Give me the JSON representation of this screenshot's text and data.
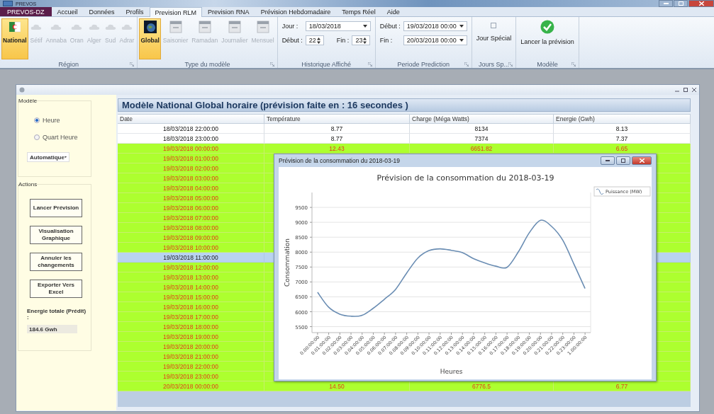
{
  "window": {
    "title": "PREVOS"
  },
  "app_menu": "PREVOS-DZ",
  "tabs": [
    {
      "label": "Accueil",
      "selected": false
    },
    {
      "label": "Données",
      "selected": false
    },
    {
      "label": "Profils",
      "selected": false
    },
    {
      "label": "Prevision RLM",
      "selected": true
    },
    {
      "label": "Prevision RNA",
      "selected": false
    },
    {
      "label": "Prévision Hebdomadaire",
      "selected": false
    },
    {
      "label": "Temps Réel",
      "selected": false
    },
    {
      "label": "Aide",
      "selected": false
    }
  ],
  "ribbon": {
    "region": {
      "title": "Région",
      "items": [
        {
          "label": "National",
          "selected": true,
          "disabled": false
        },
        {
          "label": "Sétif",
          "selected": false,
          "disabled": true
        },
        {
          "label": "Annaba",
          "selected": false,
          "disabled": true
        },
        {
          "label": "Oran",
          "selected": false,
          "disabled": true
        },
        {
          "label": "Alger",
          "selected": false,
          "disabled": true
        },
        {
          "label": "Sud",
          "selected": false,
          "disabled": true
        },
        {
          "label": "Adrar",
          "selected": false,
          "disabled": true
        }
      ]
    },
    "model_type": {
      "title": "Type du modèle",
      "items": [
        {
          "label": "Global",
          "selected": true,
          "disabled": false
        },
        {
          "label": "Saisonier",
          "selected": false,
          "disabled": true
        },
        {
          "label": "Ramadan",
          "selected": false,
          "disabled": true
        },
        {
          "label": "Journalier",
          "selected": false,
          "disabled": true
        },
        {
          "label": "Mensuel",
          "selected": false,
          "disabled": true
        }
      ]
    },
    "history": {
      "title": "Historique Affiché",
      "day_label": "Jour  :",
      "day_value": "18/03/2018",
      "start_label": "Début :",
      "start_value": "22",
      "end_label": "Fin :",
      "end_value": "23"
    },
    "period": {
      "title": "Periode Prediction",
      "start_label": "Début :",
      "start_value": "19/03/2018 00:00",
      "end_label": "Fin   :",
      "end_value": "20/03/2018 00:00"
    },
    "special_days": {
      "title": "Jours Sp...",
      "label": "Jour Spécial",
      "checked": false
    },
    "model": {
      "title": "Modèle",
      "label": "Lancer la prévision"
    }
  },
  "side_panel": {
    "model_group": "Modèle",
    "options": [
      {
        "label": "Heure",
        "selected": true
      },
      {
        "label": "Quart Heure",
        "selected": false
      }
    ],
    "mode": "Automatique",
    "actions_group": "Actions",
    "buttons": [
      "Lancer Prévision",
      "Visualisation Graphique",
      "Annuler les changements",
      "Exporter Vers Excel"
    ],
    "total_label": "Energie totale (Prédit) :",
    "total_value": "184.6 Gwh"
  },
  "table": {
    "title": "Modèle National Global horaire (prévision faite en : 16 secondes )",
    "columns": [
      "Date",
      "Température",
      "Charge (Méga Watts)",
      "Energie (Gwh)"
    ],
    "rows": [
      {
        "cells": [
          "18/03/2018 22:00:00",
          "8.77",
          "8134",
          "8.13"
        ],
        "forecast": false,
        "selected": false
      },
      {
        "cells": [
          "18/03/2018 23:00:00",
          "8.77",
          "7374",
          "7.37"
        ],
        "forecast": false,
        "selected": false
      },
      {
        "cells": [
          "19/03/2018 00:00:00",
          "12.43",
          "6651.82",
          "6.65"
        ],
        "forecast": true,
        "selected": false
      },
      {
        "cells": [
          "19/03/2018 01:00:00"
        ],
        "forecast": true,
        "selected": false
      },
      {
        "cells": [
          "19/03/2018 02:00:00"
        ],
        "forecast": true,
        "selected": false
      },
      {
        "cells": [
          "19/03/2018 03:00:00"
        ],
        "forecast": true,
        "selected": false
      },
      {
        "cells": [
          "19/03/2018 04:00:00"
        ],
        "forecast": true,
        "selected": false
      },
      {
        "cells": [
          "19/03/2018 05:00:00"
        ],
        "forecast": true,
        "selected": false
      },
      {
        "cells": [
          "19/03/2018 06:00:00"
        ],
        "forecast": true,
        "selected": false
      },
      {
        "cells": [
          "19/03/2018 07:00:00"
        ],
        "forecast": true,
        "selected": false
      },
      {
        "cells": [
          "19/03/2018 08:00:00"
        ],
        "forecast": true,
        "selected": false
      },
      {
        "cells": [
          "19/03/2018 09:00:00"
        ],
        "forecast": true,
        "selected": false
      },
      {
        "cells": [
          "19/03/2018 10:00:00"
        ],
        "forecast": true,
        "selected": false
      },
      {
        "cells": [
          "19/03/2018 11:00:00"
        ],
        "forecast": true,
        "selected": true
      },
      {
        "cells": [
          "19/03/2018 12:00:00"
        ],
        "forecast": true,
        "selected": false
      },
      {
        "cells": [
          "19/03/2018 13:00:00"
        ],
        "forecast": true,
        "selected": false
      },
      {
        "cells": [
          "19/03/2018 14:00:00"
        ],
        "forecast": true,
        "selected": false
      },
      {
        "cells": [
          "19/03/2018 15:00:00"
        ],
        "forecast": true,
        "selected": false
      },
      {
        "cells": [
          "19/03/2018 16:00:00"
        ],
        "forecast": true,
        "selected": false
      },
      {
        "cells": [
          "19/03/2018 17:00:00"
        ],
        "forecast": true,
        "selected": false
      },
      {
        "cells": [
          "19/03/2018 18:00:00"
        ],
        "forecast": true,
        "selected": false
      },
      {
        "cells": [
          "19/03/2018 19:00:00"
        ],
        "forecast": true,
        "selected": false
      },
      {
        "cells": [
          "19/03/2018 20:00:00"
        ],
        "forecast": true,
        "selected": false
      },
      {
        "cells": [
          "19/03/2018 21:00:00"
        ],
        "forecast": true,
        "selected": false
      },
      {
        "cells": [
          "19/03/2018 22:00:00"
        ],
        "forecast": true,
        "selected": false
      },
      {
        "cells": [
          "19/03/2018 23:00:00"
        ],
        "forecast": true,
        "selected": false
      },
      {
        "cells": [
          "20/03/2018 00:00:00",
          "14.50",
          "6776.5",
          "6.77"
        ],
        "forecast": true,
        "selected": false
      }
    ]
  },
  "chart_window": {
    "title": "Prévision de la consommation du 2018-03-19",
    "chart_data": {
      "type": "line",
      "title": "Prévision de la consommation du 2018-03-19",
      "xlabel": "Heures",
      "ylabel": "Consommation",
      "categories": [
        "0.00:00:00",
        "0.01:00:00",
        "0.02:00:00",
        "0.03:00:00",
        "0.04:00:00",
        "0.05:00:00",
        "0.06:00:00",
        "0.07:00:00",
        "0.08:00:00",
        "0.09:00:00",
        "0.10:00:00",
        "0.11:00:00",
        "0.12:00:00",
        "0.13:00:00",
        "0.14:00:00",
        "0.15:00:00",
        "0.16:00:00",
        "0.17:00:00",
        "0.18:00:00",
        "0.19:00:00",
        "0.20:00:00",
        "0.21:00:00",
        "0.22:00:00",
        "0.23:00:00",
        "1.00:00:00"
      ],
      "series": [
        {
          "name": "Puissance (MW)",
          "color": "#6a8db3",
          "values": [
            6650,
            6150,
            5920,
            5850,
            5880,
            6120,
            6420,
            6750,
            7300,
            7800,
            8050,
            8110,
            8060,
            7980,
            7780,
            7640,
            7530,
            7490,
            8000,
            8650,
            9070,
            8860,
            8400,
            7600,
            6780
          ]
        }
      ],
      "grid": true,
      "ylim": [
        5300,
        10000
      ],
      "yticks": [
        5500,
        6000,
        6500,
        7000,
        7500,
        8000,
        8500,
        9000,
        9500
      ]
    }
  }
}
